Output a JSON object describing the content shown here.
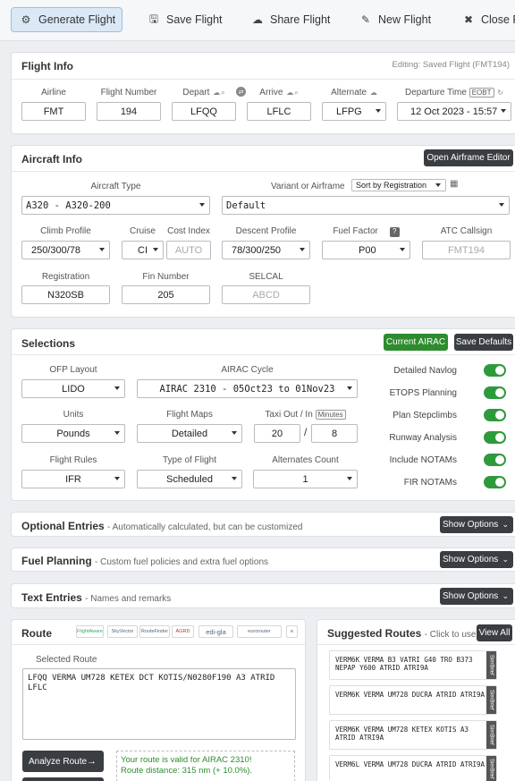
{
  "toolbar": {
    "generate": "Generate Flight",
    "save": "Save Flight",
    "share": "Share Flight",
    "new": "New Flight",
    "close": "Close Fl"
  },
  "flight_info": {
    "title": "Flight Info",
    "editing": "Editing: Saved Flight (FMT194)",
    "airline_label": "Airline",
    "airline": "FMT",
    "flight_number_label": "Flight Number",
    "flight_number": "194",
    "depart_label": "Depart",
    "depart": "LFQQ",
    "arrive_label": "Arrive",
    "arrive": "LFLC",
    "alternate_label": "Alternate",
    "alternate": "LFPG",
    "departure_time_label": "Departure Time",
    "departure_time_badge": "EOBT",
    "departure_time": "12 Oct 2023 - 15:57"
  },
  "aircraft_info": {
    "title": "Aircraft Info",
    "open_editor": "Open Airframe Editor",
    "aircraft_type_label": "Aircraft Type",
    "aircraft_type": "A320 - A320-200",
    "variant_label": "Variant or Airframe",
    "sort_by": "Sort by Registration",
    "variant": "Default",
    "climb_label": "Climb Profile",
    "climb": "250/300/78",
    "cruise_label": "Cruise",
    "cruise": "CI",
    "cost_index_label": "Cost Index",
    "cost_index_placeholder": "AUTO",
    "descent_label": "Descent Profile",
    "descent": "78/300/250",
    "fuel_factor_label": "Fuel Factor",
    "fuel_factor_help": "?",
    "fuel_factor": "P00",
    "atc_callsign_label": "ATC Callsign",
    "atc_callsign_placeholder": "FMT194",
    "registration_label": "Registration",
    "registration": "N320SB",
    "fin_label": "Fin Number",
    "fin": "205",
    "selcal_label": "SELCAL",
    "selcal_placeholder": "ABCD"
  },
  "selections": {
    "title": "Selections",
    "current_airac": "Current AIRAC",
    "save_defaults": "Save Defaults",
    "ofp_label": "OFP Layout",
    "ofp": "LIDO",
    "airac_label": "AIRAC Cycle",
    "airac": "AIRAC 2310 - 05Oct23 to 01Nov23",
    "units_label": "Units",
    "units": "Pounds",
    "maps_label": "Flight Maps",
    "maps": "Detailed",
    "taxi_label": "Taxi Out / In",
    "taxi_badge": "Minutes",
    "taxi_out": "20",
    "taxi_sep": "/",
    "taxi_in": "8",
    "rules_label": "Flight Rules",
    "rules": "IFR",
    "type_label": "Type of Flight",
    "type": "Scheduled",
    "alt_count_label": "Alternates Count",
    "alt_count": "1",
    "toggles": [
      "Detailed Navlog",
      "ETOPS Planning",
      "Plan Stepclimbs",
      "Runway Analysis",
      "Include NOTAMs",
      "FIR NOTAMs"
    ]
  },
  "optional": {
    "title": "Optional Entries",
    "sub": "- Automatically calculated, but can be customized",
    "button": "Show Options"
  },
  "fuel": {
    "title": "Fuel Planning",
    "sub": "- Custom fuel policies and extra fuel options",
    "button": "Show Options"
  },
  "text_entries": {
    "title": "Text Entries",
    "sub": "- Names and remarks",
    "button": "Show Options"
  },
  "route": {
    "title": "Route",
    "logos": [
      "FlightAware",
      "SkyVector",
      "RouteFinder",
      "AGRD",
      "edi-gla",
      "eurorouter",
      "e"
    ],
    "selected_label": "Selected Route",
    "text": "LFQQ VERMA UM728 KETEX DCT KOTIS/N0280F190 A3 ATRID LFLC",
    "analyze": "Analyze Route",
    "valid_line1": "Your route is valid for AIRAC 2310!",
    "valid_line2": "Route distance: 315 nm (+ 10.0%)."
  },
  "suggested": {
    "title": "Suggested Routes",
    "sub": "- Click to use",
    "view_all": "View All",
    "tab_label": "SimBrief",
    "routes": [
      "VERM6K VERMA B3 VATRI G40 TRO B373 NEPAP Y600 ATRID ATRI9A",
      "VERM6K VERMA UM728 DUCRA ATRID ATRI9A",
      "VERM6K VERMA UM728 KETEX KOTIS A3 ATRID ATRI9A",
      "VERM6L VERMA UM728 DUCRA ATRID ATRI9A"
    ]
  }
}
